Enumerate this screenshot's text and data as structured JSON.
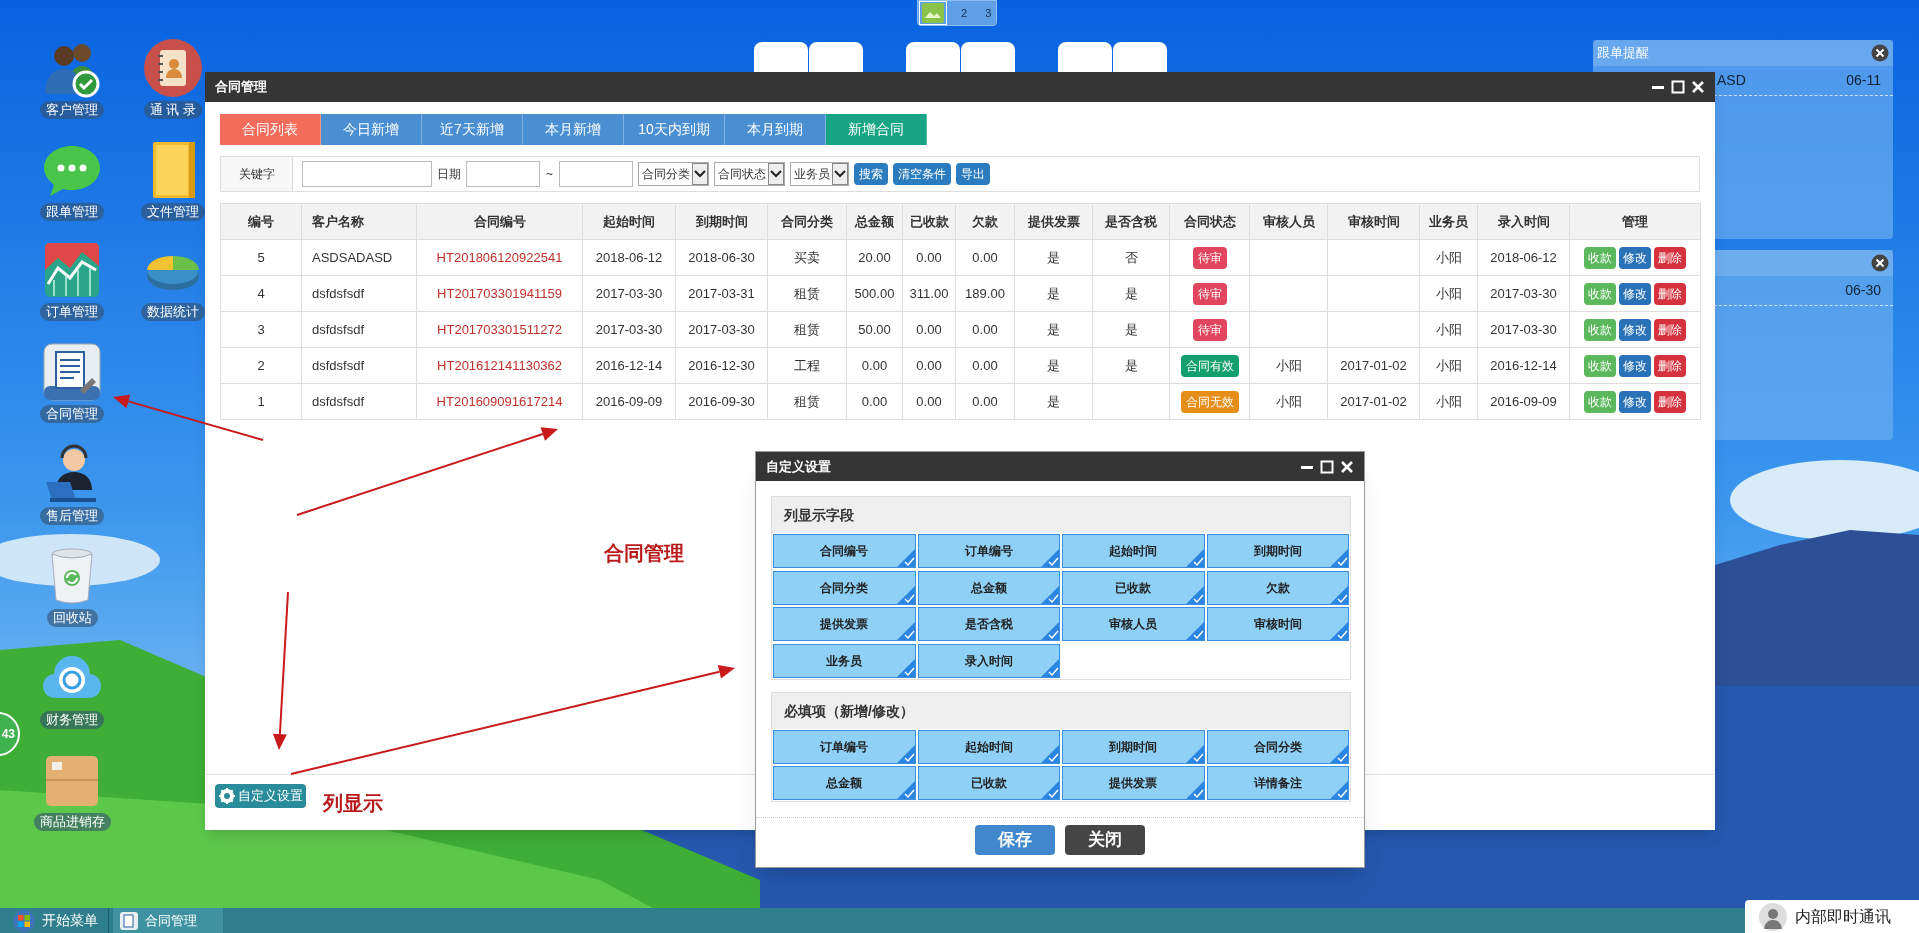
{
  "workspace_pager": {
    "pages": [
      {
        "kind": "icon",
        "selected": true
      },
      {
        "kind": "number",
        "label": "2",
        "selected": false
      },
      {
        "kind": "number",
        "label": "3",
        "selected": false
      }
    ]
  },
  "reminders": [
    {
      "title": "跟单提醒",
      "rows": [
        {
          "text": "ASD",
          "date": "06-11"
        }
      ]
    },
    {
      "rows": [
        {
          "date": "06-30"
        }
      ]
    }
  ],
  "desktop_icons": [
    {
      "kind": "people",
      "label": "客户管理"
    },
    {
      "kind": "contacts",
      "label": "通 讯 录"
    },
    {
      "kind": "chat",
      "label": "跟单管理"
    },
    {
      "kind": "folder",
      "label": "文件管理"
    },
    {
      "kind": "chart",
      "label": "订单管理"
    },
    {
      "kind": "pie",
      "label": "数据统计"
    },
    {
      "kind": "document",
      "label": "合同管理"
    },
    {
      "kind": "support",
      "label": "售后管理"
    },
    {
      "kind": "trash",
      "label": "回收站"
    },
    {
      "kind": "finance",
      "label": "财务管理"
    },
    {
      "kind": "box",
      "label": "商品进销存"
    }
  ],
  "side_badge": "43",
  "main_window": {
    "title": "合同管理",
    "tabs": [
      {
        "label": "合同列表",
        "kind": "tab",
        "selected": true
      },
      {
        "label": "今日新增",
        "kind": "tab",
        "selected": false
      },
      {
        "label": "近7天新增",
        "kind": "tab",
        "selected": false
      },
      {
        "label": "本月新增",
        "kind": "tab",
        "selected": false
      },
      {
        "label": "10天内到期",
        "kind": "tab",
        "selected": false
      },
      {
        "label": "本月到期",
        "kind": "tab",
        "selected": false
      },
      {
        "label": "新增合同",
        "kind": "action",
        "selected": false
      }
    ],
    "filter": {
      "keyword_label": "关键字",
      "date_label": "日期",
      "date_separator": "~",
      "dropdowns": [
        "合同分类",
        "合同状态",
        "业务员"
      ],
      "buttons": [
        "搜索",
        "清空条件",
        "导出"
      ]
    },
    "table": {
      "columns": [
        "编号",
        "客户名称",
        "合同编号",
        "起始时间",
        "到期时间",
        "合同分类",
        "总金额",
        "已收款",
        "欠款",
        "提供发票",
        "是否含税",
        "合同状态",
        "审核人员",
        "审核时间",
        "业务员",
        "录入时间",
        "管理"
      ],
      "rows": [
        {
          "id": "5",
          "customer": "ASDSADASD",
          "contract_no": "HT201806120922541",
          "start": "2018-06-12",
          "end": "2018-06-30",
          "category": "买卖",
          "total": "20.00",
          "received": "0.00",
          "owed": "0.00",
          "invoice": "是",
          "tax_included": "否",
          "status": {
            "text": "待审",
            "color": "#e2465e"
          },
          "salesperson": "小阳",
          "entered": "2018-06-12",
          "actions": [
            {
              "kind": "receive",
              "label": "收款"
            },
            {
              "kind": "edit",
              "label": "修改"
            },
            {
              "kind": "delete",
              "label": "删除"
            }
          ]
        },
        {
          "id": "4",
          "customer": "dsfdsfsdf",
          "contract_no": "HT201703301941159",
          "start": "2017-03-30",
          "end": "2017-03-31",
          "category": "租赁",
          "total": "500.00",
          "received": "311.00",
          "owed": "189.00",
          "invoice": "是",
          "tax_included": "是",
          "status": {
            "text": "待审",
            "color": "#e2465e"
          },
          "salesperson": "小阳",
          "entered": "2017-03-30",
          "actions": [
            {
              "kind": "receive",
              "label": "收款"
            },
            {
              "kind": "edit",
              "label": "修改"
            },
            {
              "kind": "delete",
              "label": "删除"
            }
          ]
        },
        {
          "id": "3",
          "customer": "dsfdsfsdf",
          "contract_no": "HT201703301511272",
          "start": "2017-03-30",
          "end": "2017-03-30",
          "category": "租赁",
          "total": "50.00",
          "received": "0.00",
          "owed": "0.00",
          "invoice": "是",
          "tax_included": "是",
          "status": {
            "text": "待审",
            "color": "#e2465e"
          },
          "salesperson": "小阳",
          "entered": "2017-03-30",
          "actions": [
            {
              "kind": "receive",
              "label": "收款"
            },
            {
              "kind": "edit",
              "label": "修改"
            },
            {
              "kind": "delete",
              "label": "删除"
            }
          ]
        },
        {
          "id": "2",
          "customer": "dsfdsfsdf",
          "contract_no": "HT201612141130362",
          "start": "2016-12-14",
          "end": "2016-12-30",
          "category": "工程",
          "total": "0.00",
          "received": "0.00",
          "owed": "0.00",
          "invoice": "是",
          "tax_included": "是",
          "status": {
            "text": "合同有效",
            "color": "#13a06e"
          },
          "reviewer": "小阳",
          "review_time": "2017-01-02",
          "salesperson": "小阳",
          "entered": "2016-12-14",
          "actions": [
            {
              "kind": "receive",
              "label": "收款"
            },
            {
              "kind": "edit",
              "label": "修改"
            },
            {
              "kind": "delete",
              "label": "删除"
            }
          ]
        },
        {
          "id": "1",
          "customer": "dsfdsfsdf",
          "contract_no": "HT201609091617214",
          "start": "2016-09-09",
          "end": "2016-09-30",
          "category": "租赁",
          "total": "0.00",
          "received": "0.00",
          "owed": "0.00",
          "invoice": "是",
          "status": {
            "text": "合同无效",
            "color": "#e58e1a"
          },
          "reviewer": "小阳",
          "review_time": "2017-01-02",
          "salesperson": "小阳",
          "entered": "2016-09-09",
          "actions": [
            {
              "kind": "receive",
              "label": "收款"
            },
            {
              "kind": "edit",
              "label": "修改"
            },
            {
              "kind": "delete",
              "label": "删除"
            }
          ]
        }
      ]
    },
    "footer_button": "自定义设置"
  },
  "annotations": [
    {
      "text": "合同管理"
    },
    {
      "text": "列显示"
    }
  ],
  "dialog": {
    "title": "自定义设置",
    "sections": [
      {
        "title": "列显示字段",
        "fields": [
          {
            "label": "合同编号",
            "checked": true
          },
          {
            "label": "订单编号",
            "checked": true
          },
          {
            "label": "起始时间",
            "checked": true
          },
          {
            "label": "到期时间",
            "checked": true
          },
          {
            "label": "合同分类",
            "checked": true
          },
          {
            "label": "总金额",
            "checked": true
          },
          {
            "label": "已收款",
            "checked": true
          },
          {
            "label": "欠款",
            "checked": true
          },
          {
            "label": "提供发票",
            "checked": true
          },
          {
            "label": "是否含税",
            "checked": true
          },
          {
            "label": "审核人员",
            "checked": true
          },
          {
            "label": "审核时间",
            "checked": true
          },
          {
            "label": "业务员",
            "checked": true
          },
          {
            "label": "录入时间",
            "checked": true
          }
        ]
      },
      {
        "title": "必填项（新增/修改）",
        "fields": [
          {
            "label": "订单编号",
            "checked": true
          },
          {
            "label": "起始时间",
            "checked": true
          },
          {
            "label": "到期时间",
            "checked": true
          },
          {
            "label": "合同分类",
            "checked": true
          },
          {
            "label": "总金额",
            "checked": true
          },
          {
            "label": "已收款",
            "checked": true
          },
          {
            "label": "提供发票",
            "checked": true
          },
          {
            "label": "详情备注",
            "checked": true
          }
        ]
      }
    ],
    "buttons": [
      {
        "kind": "primary",
        "label": "保存"
      },
      {
        "kind": "secondary",
        "label": "关闭"
      }
    ]
  },
  "taskbar": {
    "start": "开始菜单",
    "items": [
      {
        "label": "合同管理"
      }
    ]
  },
  "chat_widget": {
    "label": "内部即时通讯"
  }
}
